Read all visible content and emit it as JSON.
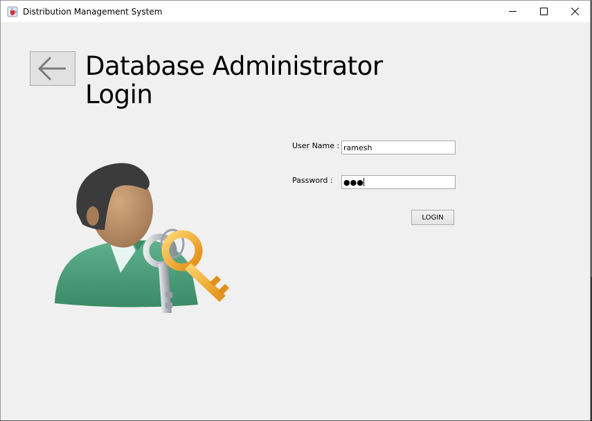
{
  "window": {
    "title": "Distribution Management System",
    "icon": "java-cup-icon",
    "controls": [
      "minimize-icon",
      "maximize-icon",
      "close-icon"
    ]
  },
  "header": {
    "back_icon": "arrow-left-icon",
    "title_line1": "Database Administrator",
    "title_line2": "Login"
  },
  "illustration": "user-with-keys",
  "form": {
    "username_label": "User Name :",
    "username_value": "ramesh",
    "password_label": "Password :",
    "password_value": "●●●",
    "login_label": "LOGIN"
  },
  "colors": {
    "window_bg": "#f0f0f0",
    "titlebar_bg": "#ffffff",
    "shirt": "#4a9a78",
    "hair": "#3a3a3a",
    "skin": "#b48a64",
    "gold_key": "#f0b030",
    "silver_key": "#b8bcc4"
  }
}
